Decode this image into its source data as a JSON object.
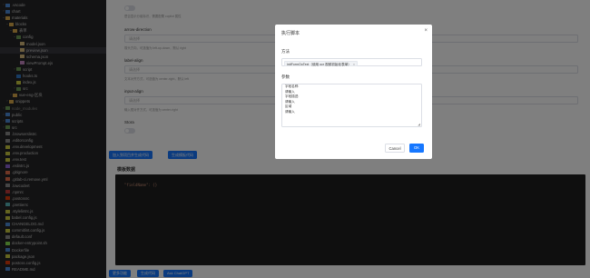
{
  "sidebar": {
    "items": [
      {
        "label": ".vscode",
        "indent": 0,
        "chev": "›",
        "color": "#4d8ad6"
      },
      {
        "label": "chart",
        "indent": 0,
        "chev": "›",
        "color": "#4d8ad6"
      },
      {
        "label": "materials",
        "indent": 0,
        "chev": "⌄",
        "color": "#d9a94b"
      },
      {
        "label": "blocks",
        "indent": 1,
        "chev": "⌄",
        "color": "#d9a94b"
      },
      {
        "label": "表单",
        "indent": 2,
        "chev": "⌄",
        "color": "#d9a94b"
      },
      {
        "label": "config",
        "indent": 3,
        "chev": "⌄",
        "color": "#6a9955"
      },
      {
        "label": "model.json",
        "indent": 4,
        "chev": "",
        "color": "#d7ba7d"
      },
      {
        "label": "preview.json",
        "indent": 4,
        "chev": "",
        "color": "#d7ba7d",
        "selected": true
      },
      {
        "label": "schema.json",
        "indent": 4,
        "chev": "",
        "color": "#d7ba7d"
      },
      {
        "label": "viewPrompt.ejs",
        "indent": 4,
        "chev": "",
        "color": "#c586c0"
      },
      {
        "label": "script",
        "indent": 3,
        "chev": "›",
        "color": "#6a9955"
      },
      {
        "label": "hooks.ts",
        "indent": 3,
        "chev": "",
        "color": "#3178c6"
      },
      {
        "label": "index.js",
        "indent": 3,
        "chev": "",
        "color": "#cbcb41"
      },
      {
        "label": "src",
        "indent": 3,
        "chev": "›",
        "color": "#6a9955"
      },
      {
        "label": "vue-eng-区块",
        "indent": 2,
        "chev": "›",
        "color": "#d9a94b"
      },
      {
        "label": "snippets",
        "indent": 1,
        "chev": "›",
        "color": "#d9a94b"
      },
      {
        "label": "node_modules",
        "indent": 0,
        "chev": "›",
        "color": "#6a9955",
        "dim": true
      },
      {
        "label": "public",
        "indent": 0,
        "chev": "›",
        "color": "#4d8ad6"
      },
      {
        "label": "scripts",
        "indent": 0,
        "chev": "›",
        "color": "#4d8ad6"
      },
      {
        "label": "src",
        "indent": 0,
        "chev": "›",
        "color": "#6a9955"
      },
      {
        "label": ".browserslistrc",
        "indent": 0,
        "chev": "",
        "color": "#8a8a8a"
      },
      {
        "label": ".editorconfig",
        "indent": 0,
        "chev": "",
        "color": "#8a8a8a"
      },
      {
        "label": ".env.development",
        "indent": 0,
        "chev": "",
        "color": "#cbcb41"
      },
      {
        "label": ".env.production",
        "indent": 0,
        "chev": "",
        "color": "#cbcb41"
      },
      {
        "label": ".env.test",
        "indent": 0,
        "chev": "",
        "color": "#cbcb41"
      },
      {
        "label": ".eslintrc.js",
        "indent": 0,
        "chev": "",
        "color": "#8a63d2"
      },
      {
        "label": ".gitignore",
        "indent": 0,
        "chev": "",
        "color": "#e06c4a"
      },
      {
        "label": ".gitlab-ci.remove.yml",
        "indent": 0,
        "chev": "",
        "color": "#e06c4a"
      },
      {
        "label": ".lowcodert",
        "indent": 0,
        "chev": "",
        "color": "#8a8a8a"
      },
      {
        "label": ".npmrc",
        "indent": 0,
        "chev": "",
        "color": "#c23a3a"
      },
      {
        "label": ".postcssrc",
        "indent": 0,
        "chev": "",
        "color": "#dd3a0a"
      },
      {
        "label": ".prettierrc",
        "indent": 0,
        "chev": "",
        "color": "#56b3b4"
      },
      {
        "label": ".stylelintrc.js",
        "indent": 0,
        "chev": "",
        "color": "#cbcb41"
      },
      {
        "label": "babel.config.js",
        "indent": 0,
        "chev": "",
        "color": "#cbcb41"
      },
      {
        "label": "CHANGELOG.md",
        "indent": 0,
        "chev": "",
        "color": "#4d8ad6"
      },
      {
        "label": "commitlint.config.js",
        "indent": 0,
        "chev": "",
        "color": "#cbcb41"
      },
      {
        "label": "default.conf",
        "indent": 0,
        "chev": "",
        "color": "#8a8a8a"
      },
      {
        "label": "docker-entrypoint.sh",
        "indent": 0,
        "chev": "",
        "color": "#89e051"
      },
      {
        "label": "Dockerfile",
        "indent": 0,
        "chev": "",
        "color": "#4d8ad6"
      },
      {
        "label": "package.json",
        "indent": 0,
        "chev": "",
        "color": "#cbcb41"
      },
      {
        "label": "postcss.config.js",
        "indent": 0,
        "chev": "",
        "color": "#dd3a0a"
      },
      {
        "label": "README.md",
        "indent": 0,
        "chev": "",
        "color": "#4d8ad6"
      }
    ]
  },
  "main": {
    "hint_top": "是否显示分组标识，需要配置 copilot 属性",
    "arrow_direction": {
      "label": "arrow-direction",
      "placeholder": "请选择",
      "hint": "箭头方向，可选值为 left-up-down，默认 right"
    },
    "label_align": {
      "label": "label-align",
      "placeholder": "请选择",
      "hint": "文本对齐方式，可选值为 center-right，默认 left"
    },
    "input_align": {
      "label": "input-align",
      "placeholder": "请选择",
      "hint": "输入框对齐方式，可选值为 center-right"
    },
    "stora": {
      "label": "Stora"
    },
    "action_buttons": {
      "primary": "加入到项目并生成代码",
      "secondary": "生成模板代码"
    },
    "section_title": "模板数据",
    "code_line": "\"fieldName\": {}",
    "bottom_buttons": {
      "a": "更多功能",
      "b": "生成代码",
      "c": "Ask ChatGPT"
    }
  },
  "modal": {
    "title": "执行脚本",
    "close_glyph": "×",
    "method_label": "方法",
    "method_tag": "initFormOoText（使用 ocr 视频初始化表单）",
    "tag_close": "×",
    "params_label": "参数",
    "params_lines": [
      "字段名称:",
      "请输入",
      "字段描述:",
      "请输入",
      "区域",
      "请输入"
    ],
    "resize_glyph": "◢",
    "cancel_label": "Cancel",
    "ok_label": "OK"
  }
}
